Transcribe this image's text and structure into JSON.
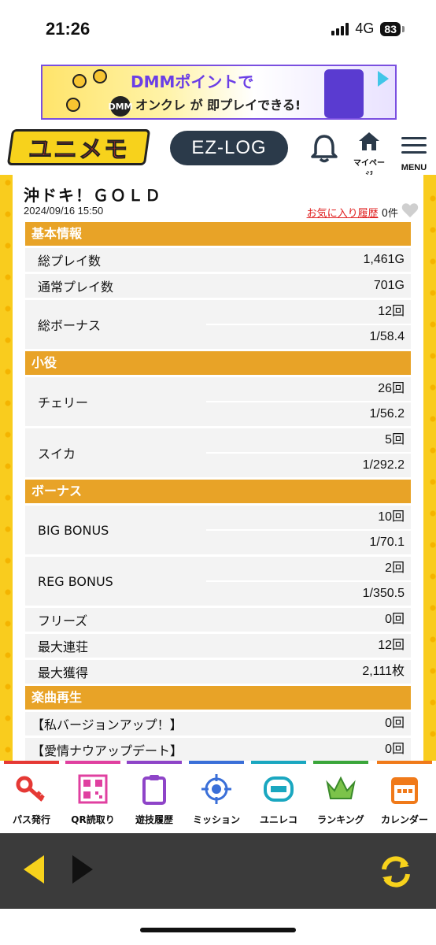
{
  "status": {
    "time": "21:26",
    "network": "4G",
    "battery": "83"
  },
  "ad": {
    "line1": "DMMポイントで",
    "line2": "オンクレ が 即プレイできる!",
    "logo_text": "DMM"
  },
  "header": {
    "logo": "ユニメモ",
    "ezlog": "EZ-LOG",
    "mypage_label": "マイページ",
    "menu_label": "MENU"
  },
  "page": {
    "title": "沖ドキ！ＧＯＬＤ",
    "date": "2024/09/16 15:50",
    "fav_link": "お気に入り履歴",
    "fav_count": "0件"
  },
  "sections": {
    "basic": {
      "title": "基本情報",
      "total_play_label": "総プレイ数",
      "total_play": "1,461G",
      "normal_play_label": "通常プレイ数",
      "normal_play": "701G",
      "total_bonus_label": "総ボーナス",
      "total_bonus_count": "12回",
      "total_bonus_rate": "1/58.4"
    },
    "small": {
      "title": "小役",
      "cherry_label": "チェリー",
      "cherry_count": "26回",
      "cherry_rate": "1/56.2",
      "suika_label": "スイカ",
      "suika_count": "5回",
      "suika_rate": "1/292.2"
    },
    "bonus": {
      "title": "ボーナス",
      "big_label": "BIG BONUS",
      "big_count": "10回",
      "big_rate": "1/70.1",
      "reg_label": "REG BONUS",
      "reg_count": "2回",
      "reg_rate": "1/350.5",
      "freeze_label": "フリーズ",
      "freeze": "0回",
      "max_streak_label": "最大連荘",
      "max_streak": "12回",
      "max_gain_label": "最大獲得",
      "max_gain": "2,111枚"
    },
    "music": {
      "title": "楽曲再生",
      "song1_label": "【私バージョンアップ！】",
      "song1": "0回",
      "song2_label": "【愛情ナウアップデート】",
      "song2": "0回"
    }
  },
  "tabs": [
    {
      "label": "パス発行",
      "color": "#e53935",
      "icon": "key-icon"
    },
    {
      "label": "QR読取り",
      "color": "#e040a0",
      "icon": "qr-icon"
    },
    {
      "label": "遊技履歴",
      "color": "#8e44c8",
      "icon": "clipboard-icon"
    },
    {
      "label": "ミッション",
      "color": "#3a6fd8",
      "icon": "target-icon"
    },
    {
      "label": "ユニレコ",
      "color": "#1aa7c0",
      "icon": "unireco-icon"
    },
    {
      "label": "ランキング",
      "color": "#3aa63a",
      "icon": "crown-icon"
    },
    {
      "label": "カレンダー",
      "color": "#f07a1a",
      "icon": "calendar-icon"
    }
  ]
}
